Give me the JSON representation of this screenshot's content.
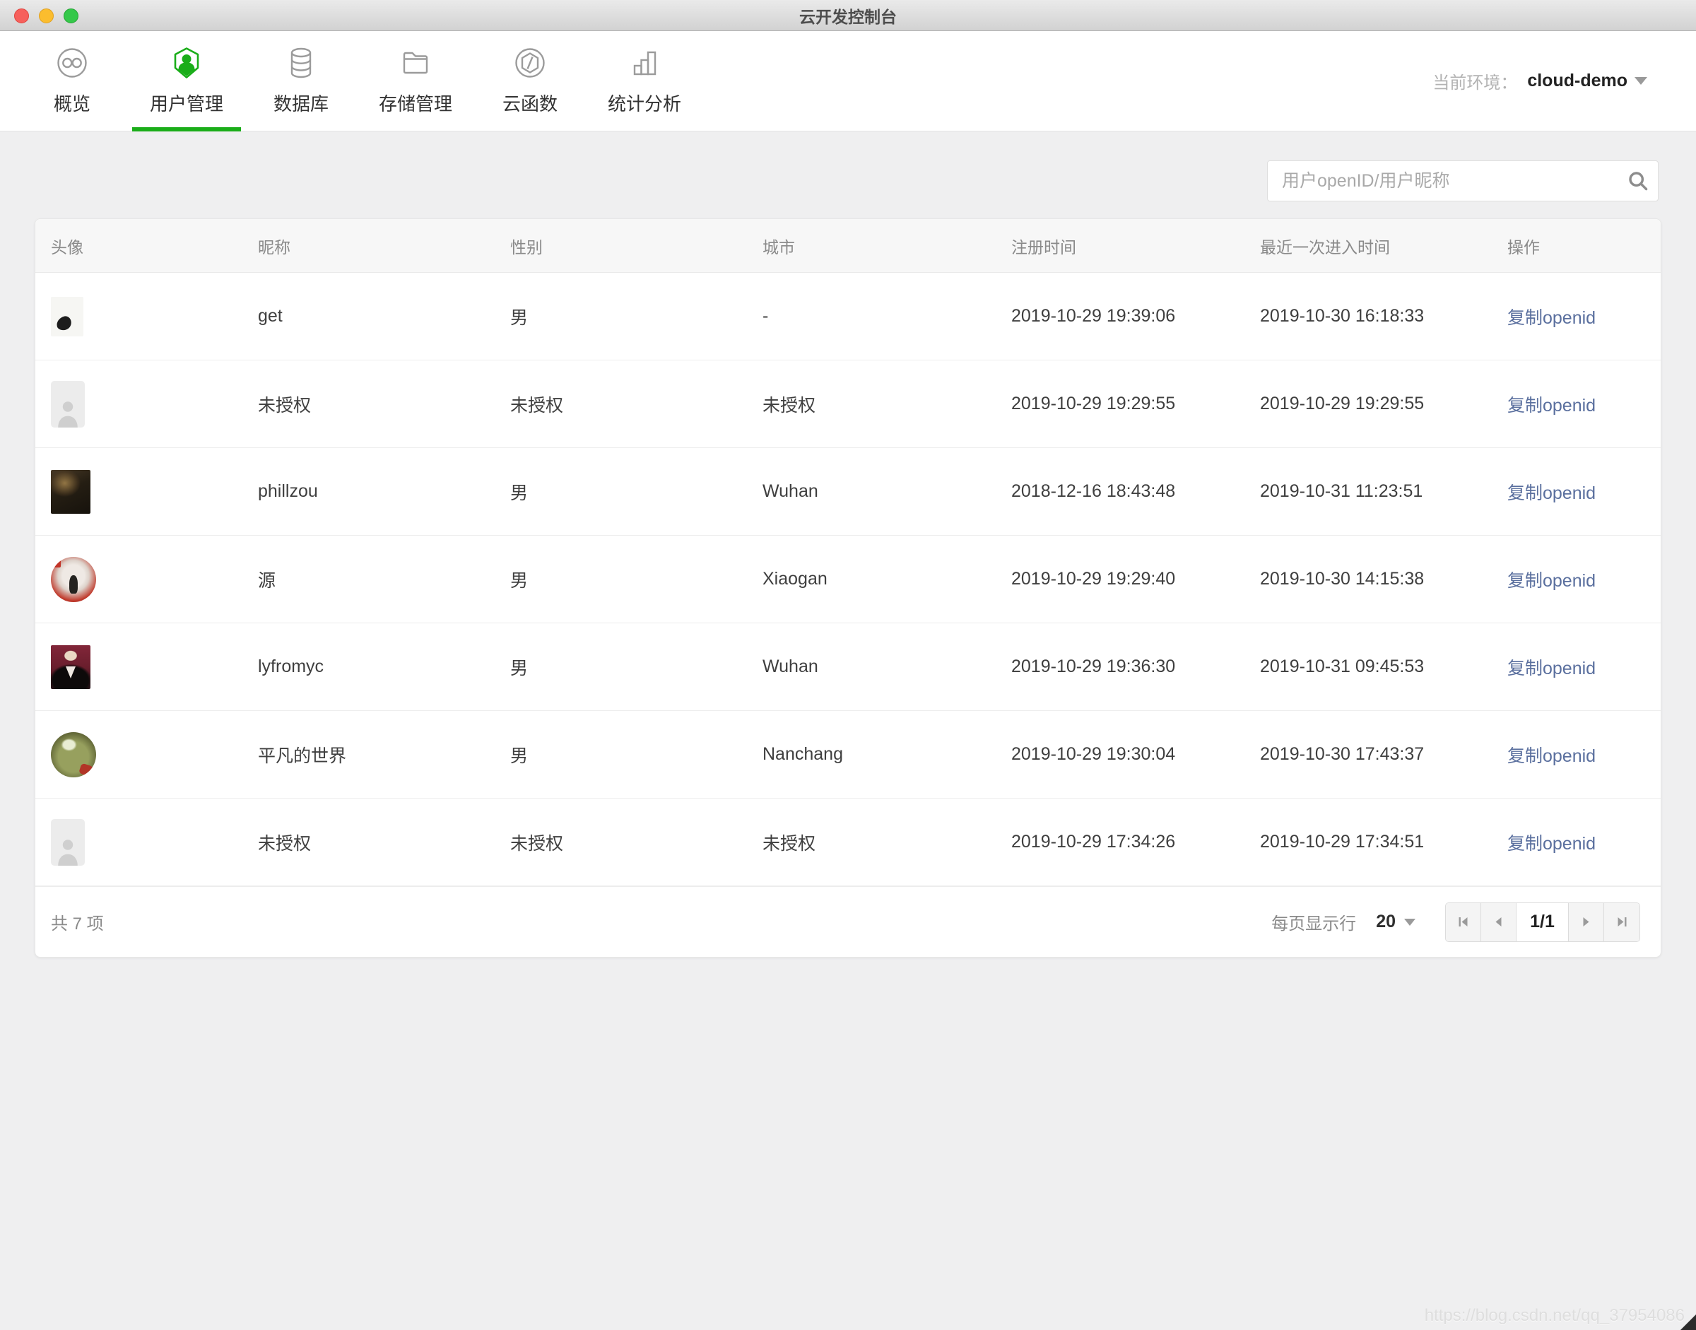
{
  "titlebar": {
    "title": "云开发控制台"
  },
  "nav": {
    "items": [
      {
        "label": "概览",
        "icon": "overview-icon",
        "active": false
      },
      {
        "label": "用户管理",
        "icon": "user-management-icon",
        "active": true
      },
      {
        "label": "数据库",
        "icon": "database-icon",
        "active": false
      },
      {
        "label": "存储管理",
        "icon": "storage-icon",
        "active": false
      },
      {
        "label": "云函数",
        "icon": "cloud-function-icon",
        "active": false
      },
      {
        "label": "统计分析",
        "icon": "statistics-icon",
        "active": false
      }
    ],
    "env_label": "当前环境：",
    "env_value": "cloud-demo"
  },
  "search": {
    "placeholder": "用户openID/用户昵称",
    "icon": "search-icon"
  },
  "table": {
    "columns": [
      "头像",
      "昵称",
      "性别",
      "城市",
      "注册时间",
      "最近一次进入时间",
      "操作"
    ],
    "action_label": "复制openid",
    "rows": [
      {
        "avatar": "photo-light",
        "nickname": "get",
        "gender": "男",
        "city": "-",
        "registered": "2019-10-29 19:39:06",
        "last_entry": "2019-10-30 16:18:33"
      },
      {
        "avatar": "placeholder",
        "nickname": "未授权",
        "gender": "未授权",
        "city": "未授权",
        "registered": "2019-10-29 19:29:55",
        "last_entry": "2019-10-29 19:29:55"
      },
      {
        "avatar": "photo-dark",
        "nickname": "phillzou",
        "gender": "男",
        "city": "Wuhan",
        "registered": "2018-12-16 18:43:48",
        "last_entry": "2019-10-31 11:23:51"
      },
      {
        "avatar": "photo-round-red",
        "nickname": "源",
        "gender": "男",
        "city": "Xiaogan",
        "registered": "2019-10-29 19:29:40",
        "last_entry": "2019-10-30 14:15:38"
      },
      {
        "avatar": "photo-maroon",
        "nickname": "lyfromyc",
        "gender": "男",
        "city": "Wuhan",
        "registered": "2019-10-29 19:36:30",
        "last_entry": "2019-10-31 09:45:53"
      },
      {
        "avatar": "photo-round-green",
        "nickname": "平凡的世界",
        "gender": "男",
        "city": "Nanchang",
        "registered": "2019-10-29 19:30:04",
        "last_entry": "2019-10-30 17:43:37"
      },
      {
        "avatar": "placeholder",
        "nickname": "未授权",
        "gender": "未授权",
        "city": "未授权",
        "registered": "2019-10-29 17:34:26",
        "last_entry": "2019-10-29 17:34:51"
      }
    ]
  },
  "footer": {
    "total_label": "共 7 项",
    "per_page_label": "每页显示行",
    "per_page_value": "20",
    "page_indicator": "1/1"
  },
  "watermark": "https://blog.csdn.net/qq_37954086",
  "colors": {
    "accent_green": "#1aad19",
    "link_blue": "#5a6f9e"
  }
}
